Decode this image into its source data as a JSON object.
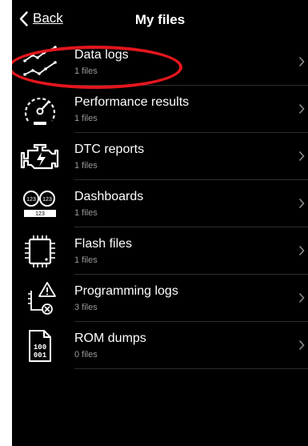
{
  "nav": {
    "back_label": "Back",
    "title": "My files"
  },
  "items": [
    {
      "label": "Data logs",
      "count": "1 files",
      "icon": "line-chart-icon"
    },
    {
      "label": "Performance results",
      "count": "1 files",
      "icon": "speedometer-icon"
    },
    {
      "label": "DTC reports",
      "count": "1 files",
      "icon": "engine-icon"
    },
    {
      "label": "Dashboards",
      "count": "1 files",
      "icon": "gauges-icon"
    },
    {
      "label": "Flash files",
      "count": "1 files",
      "icon": "chip-icon"
    },
    {
      "label": "Programming logs",
      "count": "3 files",
      "icon": "warning-log-icon"
    },
    {
      "label": "ROM dumps",
      "count": "0 files",
      "icon": "binary-file-icon"
    }
  ],
  "dashboards_icon_text": {
    "gauge": "123",
    "display": "123"
  },
  "rom_icon_text": {
    "line1": "100",
    "line2": "001"
  },
  "colors": {
    "background": "#000000",
    "text": "#ffffff",
    "subtext": "#9a9a9a",
    "highlight": "#e3161d"
  }
}
